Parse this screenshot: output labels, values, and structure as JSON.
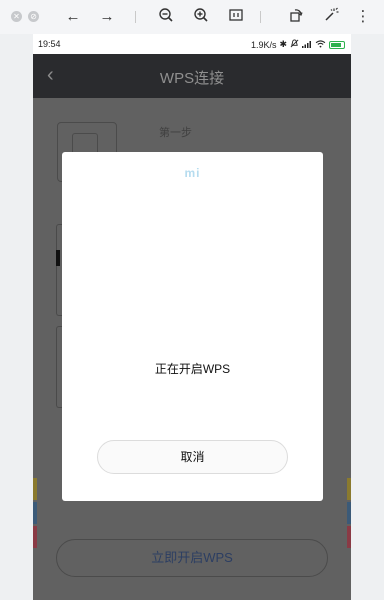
{
  "viewer": {
    "icons": [
      "close-window-icon",
      "minimize-window-icon",
      "arrow-left-icon",
      "arrow-right-icon",
      "zoom-out-icon",
      "zoom-in-icon",
      "actual-size-icon",
      "rotate-icon",
      "magic-wand-icon",
      "more-icon"
    ]
  },
  "status_bar": {
    "time": "19:54",
    "speed": "1.9K/s",
    "battery_color": "#2eb14e",
    "battery_level": 0.8
  },
  "header": {
    "title": "WPS连接"
  },
  "step": {
    "title": "第一步"
  },
  "open_wps_button": {
    "label": "立即开启WPS"
  },
  "dialog": {
    "logo": "mi",
    "logo_color": "#b6dcef",
    "message": "正在开启WPS",
    "cancel_label": "取消"
  },
  "colors": {
    "header_bg": "#2a2b2e",
    "overlay_bg": "#616161",
    "button_text": "#2c3e62",
    "stripe_yellow": "#8a7a2e",
    "stripe_blue": "#3b5a78",
    "stripe_red": "#8a3a45"
  }
}
